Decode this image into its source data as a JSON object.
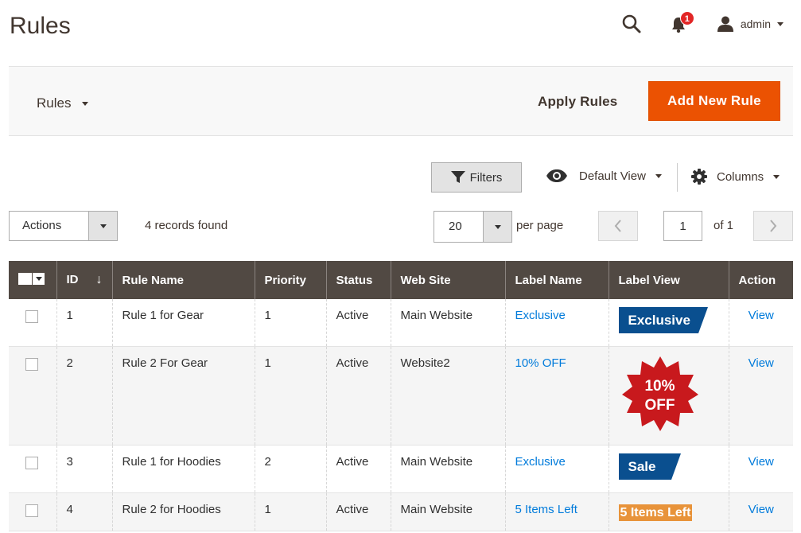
{
  "header": {
    "title": "Rules",
    "notification_count": "1",
    "user_name": "admin"
  },
  "toolbar": {
    "rules_dropdown_label": "Rules",
    "apply_rules_label": "Apply Rules",
    "add_new_rule_label": "Add New Rule"
  },
  "grid_controls": {
    "filters_label": "Filters",
    "view_label": "Default View",
    "columns_label": "Columns",
    "actions_label": "Actions",
    "records_found": "4 records found",
    "per_page_value": "20",
    "per_page_label": "per page",
    "current_page": "1",
    "of_pages": "of 1"
  },
  "table": {
    "columns": {
      "id": "ID",
      "rule_name": "Rule Name",
      "priority": "Priority",
      "status": "Status",
      "website": "Web Site",
      "label_name": "Label Name",
      "label_view": "Label View",
      "action": "Action"
    },
    "rows": [
      {
        "id": "1",
        "rule_name": "Rule 1 for Gear",
        "priority": "1",
        "status": "Active",
        "website": "Main Website",
        "label_name": "Exclusive",
        "label_view": "Exclusive",
        "action": "View"
      },
      {
        "id": "2",
        "rule_name": "Rule 2 For Gear",
        "priority": "1",
        "status": "Active",
        "website": "Website2",
        "label_name": "10% OFF",
        "label_view_line1": "10%",
        "label_view_line2": "OFF",
        "action": "View"
      },
      {
        "id": "3",
        "rule_name": "Rule 1 for Hoodies",
        "priority": "2",
        "status": "Active",
        "website": "Main Website",
        "label_name": "Exclusive",
        "label_view": "Sale",
        "action": "View"
      },
      {
        "id": "4",
        "rule_name": "Rule 2 for Hoodies",
        "priority": "1",
        "status": "Active",
        "website": "Main Website",
        "label_name": "5 Items Left",
        "label_view": "5 Items Left",
        "action": "View"
      }
    ]
  },
  "colors": {
    "accent": "#eb5202",
    "header_bg": "#514943",
    "link": "#007bdb",
    "label_blue": "#0a4f8f",
    "label_red": "#c8191d",
    "label_orange": "#e8933a"
  },
  "icons": [
    "search-icon",
    "bell-icon",
    "user-icon",
    "filter-icon",
    "eye-icon",
    "gear-icon",
    "chevron-left-icon",
    "chevron-right-icon"
  ]
}
